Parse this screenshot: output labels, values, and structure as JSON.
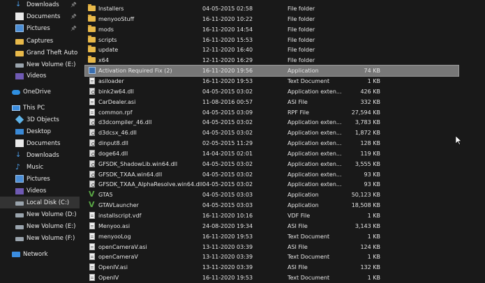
{
  "nav": {
    "items": [
      {
        "label": "Downloads",
        "icon": "download-arrow-icon",
        "pinned": true
      },
      {
        "label": "Documents",
        "icon": "documents-icon",
        "pinned": true
      },
      {
        "label": "Pictures",
        "icon": "pictures-icon",
        "pinned": true
      },
      {
        "label": "Captures",
        "icon": "folder-icon",
        "pinned": false
      },
      {
        "label": "Grand Theft Auto V",
        "icon": "folder-icon",
        "pinned": false
      },
      {
        "label": "New Volume (E:)",
        "icon": "drive-icon",
        "pinned": false
      },
      {
        "label": "Videos",
        "icon": "videos-icon",
        "pinned": false
      },
      {
        "label": "OneDrive",
        "icon": "onedrive-icon",
        "pinned": false
      },
      {
        "label": "This PC",
        "icon": "pc-icon",
        "pinned": false
      },
      {
        "label": "3D Objects",
        "icon": "3d-objects-icon",
        "pinned": false
      },
      {
        "label": "Desktop",
        "icon": "desktop-icon",
        "pinned": false
      },
      {
        "label": "Documents",
        "icon": "documents-icon",
        "pinned": false
      },
      {
        "label": "Downloads",
        "icon": "download-arrow-icon",
        "pinned": false
      },
      {
        "label": "Music",
        "icon": "music-icon",
        "pinned": false
      },
      {
        "label": "Pictures",
        "icon": "pictures-icon",
        "pinned": false
      },
      {
        "label": "Videos",
        "icon": "videos-icon",
        "pinned": false
      },
      {
        "label": "Local Disk (C:)",
        "icon": "drive-icon",
        "pinned": false,
        "selected": true
      },
      {
        "label": "New Volume (D:)",
        "icon": "drive-icon",
        "pinned": false
      },
      {
        "label": "New Volume (E:)",
        "icon": "drive-icon",
        "pinned": false
      },
      {
        "label": "New Volume (F:)",
        "icon": "drive-icon",
        "pinned": false
      },
      {
        "label": "Network",
        "icon": "network-icon",
        "pinned": false
      }
    ]
  },
  "files": [
    {
      "name": "Installers",
      "date": "04-05-2015 02:58",
      "type": "File folder",
      "size": "",
      "icon": "folder"
    },
    {
      "name": "menyooStuff",
      "date": "16-11-2020 10:22",
      "type": "File folder",
      "size": "",
      "icon": "folder"
    },
    {
      "name": "mods",
      "date": "16-11-2020 14:54",
      "type": "File folder",
      "size": "",
      "icon": "folder"
    },
    {
      "name": "scripts",
      "date": "16-11-2020 15:53",
      "type": "File folder",
      "size": "",
      "icon": "folder"
    },
    {
      "name": "update",
      "date": "12-11-2020 16:40",
      "type": "File folder",
      "size": "",
      "icon": "folder"
    },
    {
      "name": "x64",
      "date": "12-11-2020 16:29",
      "type": "File folder",
      "size": "",
      "icon": "folder"
    },
    {
      "name": "Activation Required Fix (2)",
      "date": "16-11-2020 19:56",
      "type": "Application",
      "size": "74 KB",
      "icon": "app",
      "selected": true
    },
    {
      "name": "asiloader",
      "date": "16-11-2020 19:53",
      "type": "Text Document",
      "size": "1 KB",
      "icon": "text"
    },
    {
      "name": "bink2w64.dll",
      "date": "04-05-2015 03:02",
      "type": "Application exten...",
      "size": "426 KB",
      "icon": "dll"
    },
    {
      "name": "CarDealer.asi",
      "date": "11-08-2016 00:57",
      "type": "ASI File",
      "size": "332 KB",
      "icon": "text"
    },
    {
      "name": "common.rpf",
      "date": "04-05-2015 03:09",
      "type": "RPF File",
      "size": "27,594 KB",
      "icon": "text"
    },
    {
      "name": "d3dcompiler_46.dll",
      "date": "04-05-2015 03:02",
      "type": "Application exten...",
      "size": "3,783 KB",
      "icon": "dll"
    },
    {
      "name": "d3dcsx_46.dll",
      "date": "04-05-2015 03:02",
      "type": "Application exten...",
      "size": "1,872 KB",
      "icon": "dll"
    },
    {
      "name": "dinput8.dll",
      "date": "02-05-2015 11:29",
      "type": "Application exten...",
      "size": "128 KB",
      "icon": "dll"
    },
    {
      "name": "doge64.dll",
      "date": "14-04-2015 02:01",
      "type": "Application exten...",
      "size": "119 KB",
      "icon": "dll"
    },
    {
      "name": "GFSDK_ShadowLib.win64.dll",
      "date": "04-05-2015 03:02",
      "type": "Application exten...",
      "size": "3,555 KB",
      "icon": "dll"
    },
    {
      "name": "GFSDK_TXAA.win64.dll",
      "date": "04-05-2015 03:02",
      "type": "Application exten...",
      "size": "93 KB",
      "icon": "dll"
    },
    {
      "name": "GFSDK_TXAA_AlphaResolve.win64.dll",
      "date": "04-05-2015 03:02",
      "type": "Application exten...",
      "size": "93 KB",
      "icon": "dll"
    },
    {
      "name": "GTA5",
      "date": "04-05-2015 03:03",
      "type": "Application",
      "size": "50,123 KB",
      "icon": "gta"
    },
    {
      "name": "GTAVLauncher",
      "date": "04-05-2015 03:03",
      "type": "Application",
      "size": "18,508 KB",
      "icon": "gta"
    },
    {
      "name": "installscript.vdf",
      "date": "16-11-2020 10:16",
      "type": "VDF File",
      "size": "1 KB",
      "icon": "text"
    },
    {
      "name": "Menyoo.asi",
      "date": "24-08-2020 19:34",
      "type": "ASI File",
      "size": "3,143 KB",
      "icon": "text"
    },
    {
      "name": "menyooLog",
      "date": "16-11-2020 19:53",
      "type": "Text Document",
      "size": "1 KB",
      "icon": "text"
    },
    {
      "name": "openCameraV.asi",
      "date": "13-11-2020 03:39",
      "type": "ASI File",
      "size": "124 KB",
      "icon": "text"
    },
    {
      "name": "openCameraV",
      "date": "13-11-2020 03:39",
      "type": "Text Document",
      "size": "1 KB",
      "icon": "text"
    },
    {
      "name": "OpenIV.asi",
      "date": "13-11-2020 03:39",
      "type": "ASI File",
      "size": "132 KB",
      "icon": "text"
    },
    {
      "name": "OpenIV",
      "date": "16-11-2020 19:53",
      "type": "Text Document",
      "size": "1 KB",
      "icon": "text"
    }
  ],
  "colors": {
    "background": "#191919",
    "selection": "#777777",
    "folder": "#e8b94a",
    "accent": "#4a9ce8"
  }
}
